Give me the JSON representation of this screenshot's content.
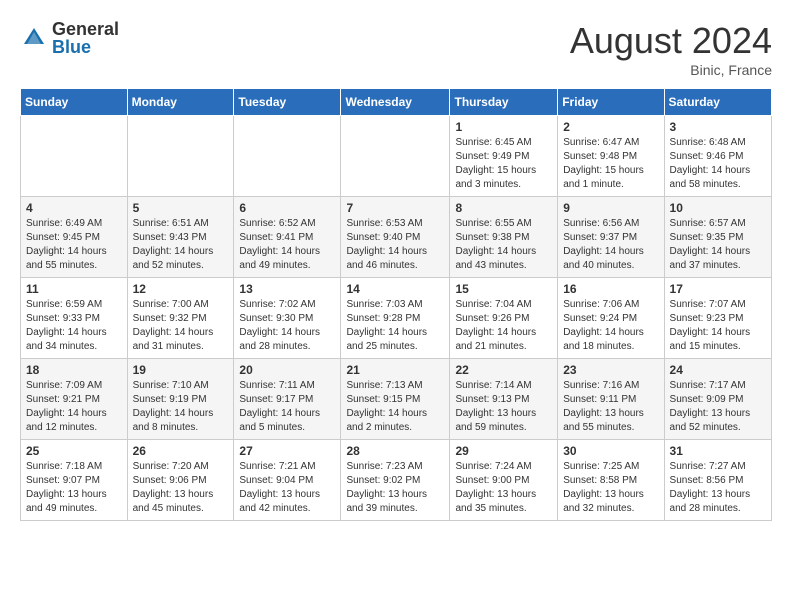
{
  "header": {
    "logo_general": "General",
    "logo_blue": "Blue",
    "month_year": "August 2024",
    "location": "Binic, France"
  },
  "weekdays": [
    "Sunday",
    "Monday",
    "Tuesday",
    "Wednesday",
    "Thursday",
    "Friday",
    "Saturday"
  ],
  "weeks": [
    [
      {
        "day": "",
        "info": ""
      },
      {
        "day": "",
        "info": ""
      },
      {
        "day": "",
        "info": ""
      },
      {
        "day": "",
        "info": ""
      },
      {
        "day": "1",
        "info": "Sunrise: 6:45 AM\nSunset: 9:49 PM\nDaylight: 15 hours\nand 3 minutes."
      },
      {
        "day": "2",
        "info": "Sunrise: 6:47 AM\nSunset: 9:48 PM\nDaylight: 15 hours\nand 1 minute."
      },
      {
        "day": "3",
        "info": "Sunrise: 6:48 AM\nSunset: 9:46 PM\nDaylight: 14 hours\nand 58 minutes."
      }
    ],
    [
      {
        "day": "4",
        "info": "Sunrise: 6:49 AM\nSunset: 9:45 PM\nDaylight: 14 hours\nand 55 minutes."
      },
      {
        "day": "5",
        "info": "Sunrise: 6:51 AM\nSunset: 9:43 PM\nDaylight: 14 hours\nand 52 minutes."
      },
      {
        "day": "6",
        "info": "Sunrise: 6:52 AM\nSunset: 9:41 PM\nDaylight: 14 hours\nand 49 minutes."
      },
      {
        "day": "7",
        "info": "Sunrise: 6:53 AM\nSunset: 9:40 PM\nDaylight: 14 hours\nand 46 minutes."
      },
      {
        "day": "8",
        "info": "Sunrise: 6:55 AM\nSunset: 9:38 PM\nDaylight: 14 hours\nand 43 minutes."
      },
      {
        "day": "9",
        "info": "Sunrise: 6:56 AM\nSunset: 9:37 PM\nDaylight: 14 hours\nand 40 minutes."
      },
      {
        "day": "10",
        "info": "Sunrise: 6:57 AM\nSunset: 9:35 PM\nDaylight: 14 hours\nand 37 minutes."
      }
    ],
    [
      {
        "day": "11",
        "info": "Sunrise: 6:59 AM\nSunset: 9:33 PM\nDaylight: 14 hours\nand 34 minutes."
      },
      {
        "day": "12",
        "info": "Sunrise: 7:00 AM\nSunset: 9:32 PM\nDaylight: 14 hours\nand 31 minutes."
      },
      {
        "day": "13",
        "info": "Sunrise: 7:02 AM\nSunset: 9:30 PM\nDaylight: 14 hours\nand 28 minutes."
      },
      {
        "day": "14",
        "info": "Sunrise: 7:03 AM\nSunset: 9:28 PM\nDaylight: 14 hours\nand 25 minutes."
      },
      {
        "day": "15",
        "info": "Sunrise: 7:04 AM\nSunset: 9:26 PM\nDaylight: 14 hours\nand 21 minutes."
      },
      {
        "day": "16",
        "info": "Sunrise: 7:06 AM\nSunset: 9:24 PM\nDaylight: 14 hours\nand 18 minutes."
      },
      {
        "day": "17",
        "info": "Sunrise: 7:07 AM\nSunset: 9:23 PM\nDaylight: 14 hours\nand 15 minutes."
      }
    ],
    [
      {
        "day": "18",
        "info": "Sunrise: 7:09 AM\nSunset: 9:21 PM\nDaylight: 14 hours\nand 12 minutes."
      },
      {
        "day": "19",
        "info": "Sunrise: 7:10 AM\nSunset: 9:19 PM\nDaylight: 14 hours\nand 8 minutes."
      },
      {
        "day": "20",
        "info": "Sunrise: 7:11 AM\nSunset: 9:17 PM\nDaylight: 14 hours\nand 5 minutes."
      },
      {
        "day": "21",
        "info": "Sunrise: 7:13 AM\nSunset: 9:15 PM\nDaylight: 14 hours\nand 2 minutes."
      },
      {
        "day": "22",
        "info": "Sunrise: 7:14 AM\nSunset: 9:13 PM\nDaylight: 13 hours\nand 59 minutes."
      },
      {
        "day": "23",
        "info": "Sunrise: 7:16 AM\nSunset: 9:11 PM\nDaylight: 13 hours\nand 55 minutes."
      },
      {
        "day": "24",
        "info": "Sunrise: 7:17 AM\nSunset: 9:09 PM\nDaylight: 13 hours\nand 52 minutes."
      }
    ],
    [
      {
        "day": "25",
        "info": "Sunrise: 7:18 AM\nSunset: 9:07 PM\nDaylight: 13 hours\nand 49 minutes."
      },
      {
        "day": "26",
        "info": "Sunrise: 7:20 AM\nSunset: 9:06 PM\nDaylight: 13 hours\nand 45 minutes."
      },
      {
        "day": "27",
        "info": "Sunrise: 7:21 AM\nSunset: 9:04 PM\nDaylight: 13 hours\nand 42 minutes."
      },
      {
        "day": "28",
        "info": "Sunrise: 7:23 AM\nSunset: 9:02 PM\nDaylight: 13 hours\nand 39 minutes."
      },
      {
        "day": "29",
        "info": "Sunrise: 7:24 AM\nSunset: 9:00 PM\nDaylight: 13 hours\nand 35 minutes."
      },
      {
        "day": "30",
        "info": "Sunrise: 7:25 AM\nSunset: 8:58 PM\nDaylight: 13 hours\nand 32 minutes."
      },
      {
        "day": "31",
        "info": "Sunrise: 7:27 AM\nSunset: 8:56 PM\nDaylight: 13 hours\nand 28 minutes."
      }
    ]
  ]
}
